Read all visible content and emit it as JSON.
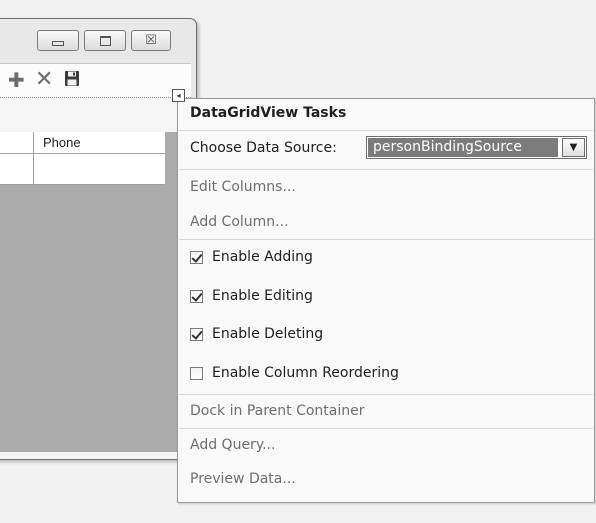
{
  "form": {
    "title_buttons": {
      "minimize_icon": "minimize-icon",
      "maximize_icon": "maximize-icon",
      "close_icon": "close-icon",
      "close_glyph": "☒"
    },
    "toolbar": {
      "add_glyph": "✚",
      "delete_glyph": "✕"
    },
    "grid": {
      "column_header": "Phone",
      "scroll_right_glyph": "▸"
    },
    "smart_tag_glyph": "◂"
  },
  "panel": {
    "title": "DataGridView Tasks",
    "data_source_label": "Choose Data Source:",
    "data_source_value": "personBindingSource",
    "dropdown_glyph": "▼",
    "links": {
      "edit_columns": "Edit Columns...",
      "add_column": "Add Column...",
      "dock": "Dock in Parent Container",
      "add_query": "Add Query...",
      "preview_data": "Preview Data..."
    },
    "options": [
      {
        "label": "Enable Adding",
        "checked": true
      },
      {
        "label": "Enable Editing",
        "checked": true
      },
      {
        "label": "Enable Deleting",
        "checked": true
      },
      {
        "label": "Enable Column Reordering",
        "checked": false
      }
    ]
  }
}
